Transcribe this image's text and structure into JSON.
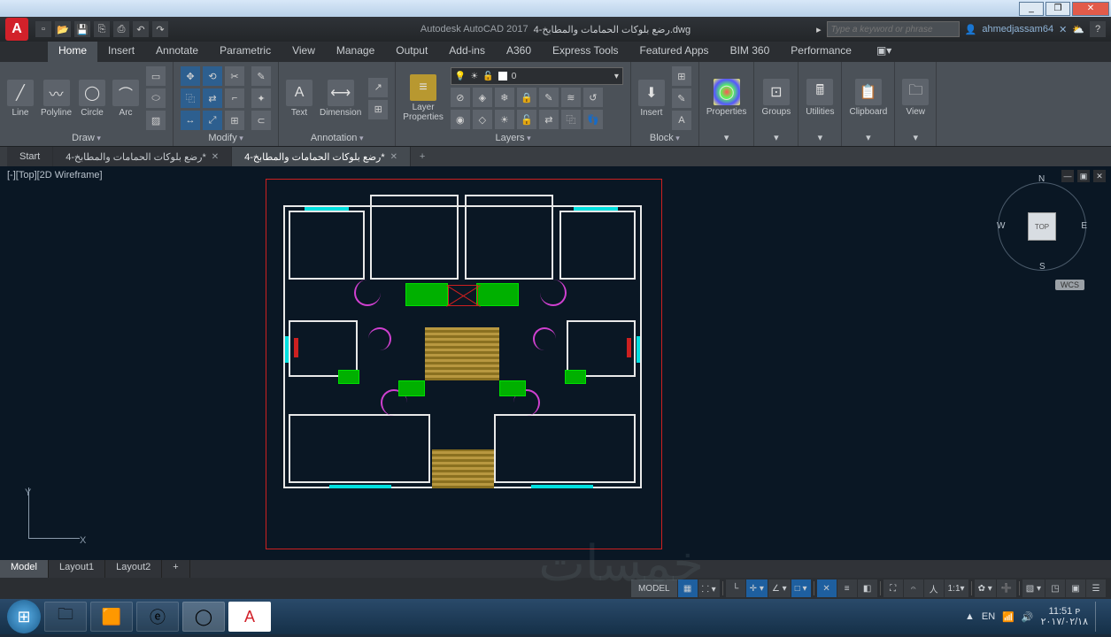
{
  "window": {
    "min": "_",
    "max": "❐",
    "close": "✕"
  },
  "title": {
    "app": "Autodesk AutoCAD 2017",
    "file": "رضع بلوكات الحمامات والمطابخ-4.dwg",
    "search_ph": "Type a keyword or phrase",
    "user": "ahmedjassam64",
    "help": "?"
  },
  "menu": [
    "Home",
    "Insert",
    "Annotate",
    "Parametric",
    "View",
    "Manage",
    "Output",
    "Add-ins",
    "A360",
    "Express Tools",
    "Featured Apps",
    "BIM 360",
    "Performance"
  ],
  "menu_active": 0,
  "ribbon": {
    "draw": {
      "label": "Draw",
      "items": [
        "Line",
        "Polyline",
        "Circle",
        "Arc"
      ]
    },
    "modify": {
      "label": "Modify"
    },
    "annotation": {
      "label": "Annotation",
      "text": "Text",
      "dim": "Dimension"
    },
    "layers": {
      "label": "Layers",
      "lp": "Layer\nProperties",
      "current": "0"
    },
    "block": {
      "label": "Block",
      "insert": "Insert"
    },
    "properties": {
      "label": "Properties"
    },
    "groups": {
      "label": "Groups"
    },
    "utilities": {
      "label": "Utilities"
    },
    "clipboard": {
      "label": "Clipboard"
    },
    "view": {
      "label": "View"
    }
  },
  "doc_tabs": {
    "start": "Start",
    "t1": "رضع بلوكات الحمامات والمطابخ-4*",
    "t2": "رضع بلوكات الحمامات والمطابخ-4*",
    "add": "+"
  },
  "viewport": {
    "label": "[-][Top][2D Wireframe]",
    "cube": "TOP",
    "wcs": "WCS",
    "N": "N",
    "S": "S",
    "E": "E",
    "W": "W"
  },
  "ucs": {
    "x": "X",
    "y": "Y"
  },
  "layout": {
    "model": "Model",
    "l1": "Layout1",
    "l2": "Layout2",
    "add": "+"
  },
  "status": {
    "model": "MODEL",
    "scale": "1:1"
  },
  "taskbar": {
    "lang": "EN",
    "time": "11:51 ᴘ",
    "date": "٢٠١٧/٠٢/١٨"
  },
  "watermark": "خمسات"
}
